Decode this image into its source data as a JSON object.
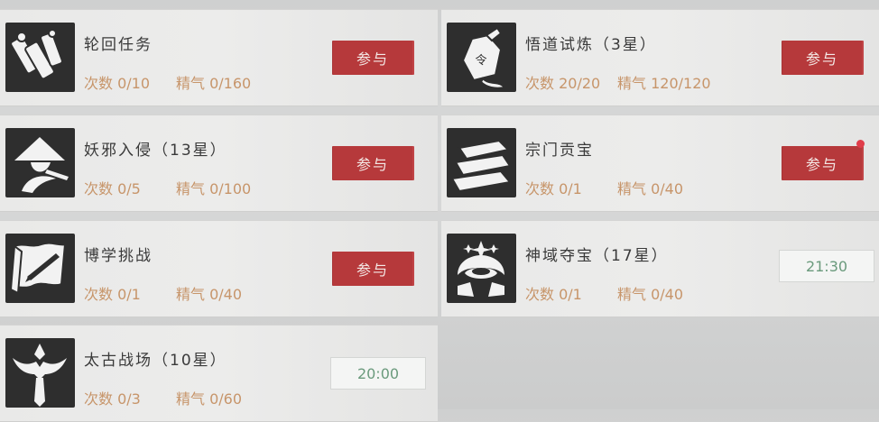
{
  "cards": [
    {
      "title": "轮回任务",
      "count": "次数 0/10",
      "energy": "精气 0/160",
      "action": "参与",
      "icon": "scroll-bundle-icon"
    },
    {
      "title": "悟道试炼（3星）",
      "count": "次数 20/20",
      "energy": "精气 120/120",
      "action": "参与",
      "icon": "talisman-pouch-icon"
    },
    {
      "title": "妖邪入侵（13星）",
      "count": "次数 0/5",
      "energy": "精气 0/100",
      "action": "参与",
      "icon": "straw-hat-warrior-icon"
    },
    {
      "title": "宗门贡宝",
      "count": "次数 0/1",
      "energy": "精气 0/40",
      "action": "参与",
      "icon": "pillow-stack-icon",
      "badge": true
    },
    {
      "title": "博学挑战",
      "count": "次数 0/1",
      "energy": "精气 0/40",
      "action": "参与",
      "icon": "scroll-brush-icon"
    },
    {
      "title": "神域夺宝（17星）",
      "count": "次数 0/1",
      "energy": "精气 0/40",
      "time": "21:30",
      "icon": "treasure-ingot-icon"
    },
    {
      "title": "太古战场（10星）",
      "count": "次数 0/3",
      "energy": "精气 0/60",
      "time": "20:00",
      "icon": "winged-sword-icon"
    }
  ],
  "colors": {
    "button": "#b6393b",
    "stat": "#c7956a",
    "time": "#6a9a7c",
    "badge": "#e03d4a"
  }
}
